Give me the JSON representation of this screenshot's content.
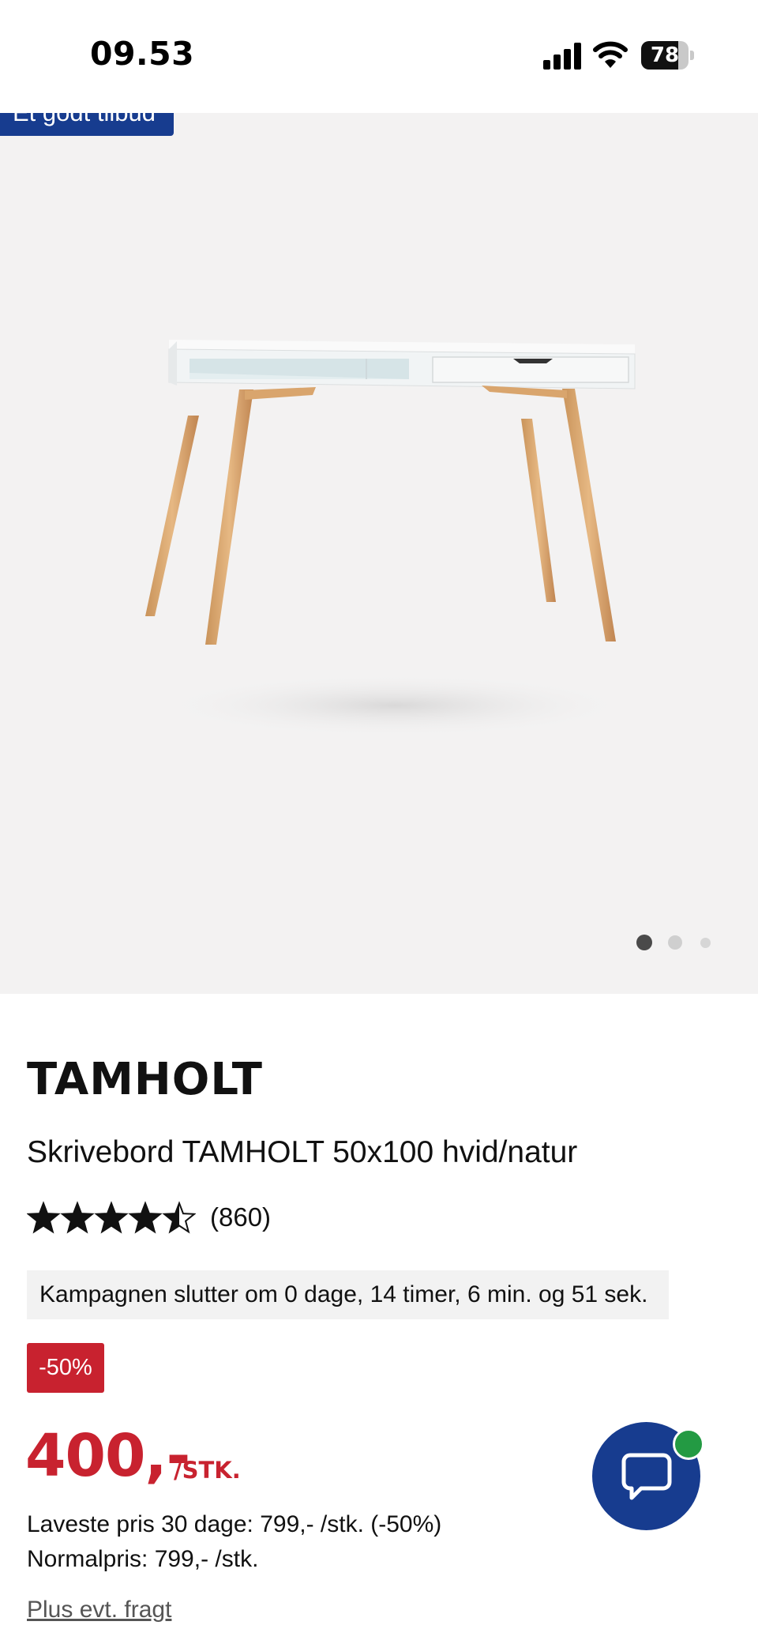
{
  "status_bar": {
    "time": "09.53",
    "battery_level": "78",
    "battery_fraction": 0.78,
    "icons": [
      "cellular-signal-icon",
      "wifi-icon",
      "battery-icon"
    ]
  },
  "gallery": {
    "badge": "Et godt tilbud",
    "image_alt": "desk-photo",
    "page_count": 3,
    "current_page": 1
  },
  "product": {
    "brand": "TAMHOLT",
    "title": "Skrivebord TAMHOLT 50x100 hvid/natur",
    "rating": 4.5,
    "rating_max": 5,
    "review_count": "(860)",
    "campaign_text": "Kampagnen slutter om 0 dage, 14 timer, 6 min. og 51 sek.",
    "discount_badge": "-50%",
    "price": "400,-",
    "price_unit": "/STK.",
    "lowest_price": "Laveste pris 30 dage: 799,- /stk. (-50%)",
    "normal_price": "Normalpris: 799,- /stk.",
    "shipping": "Plus evt. fragt"
  },
  "chat": {
    "icon": "chat-bubble-icon",
    "status": "online"
  },
  "colors": {
    "brand_blue": "#173c8f",
    "sale_red": "#c8222f",
    "online_green": "#239a43",
    "gallery_bg": "#f3f2f2"
  }
}
